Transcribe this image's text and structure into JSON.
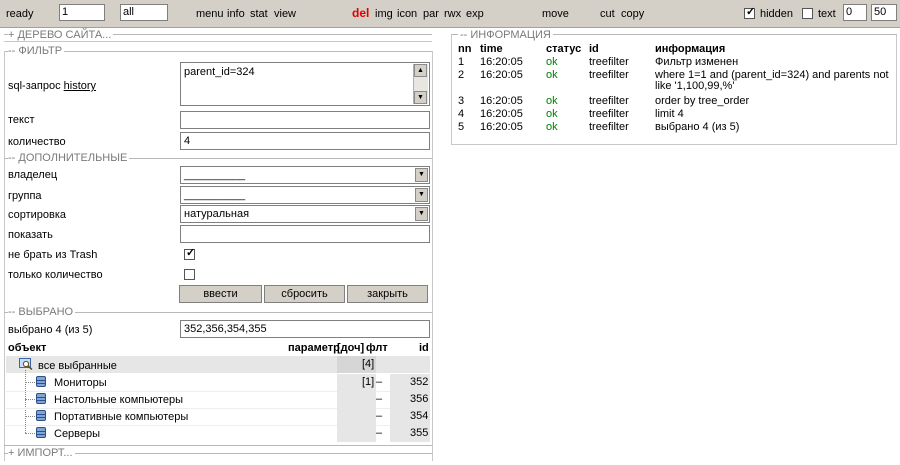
{
  "toolbar": {
    "status": "ready",
    "page_value": "1",
    "filter_value": "all",
    "menu": "menu",
    "info": "info",
    "stat": "stat",
    "view": "view",
    "del": "del",
    "img": "img",
    "icon": "icon",
    "par": "par",
    "rwx": "rwx",
    "exp": "exp",
    "move": "move",
    "cut": "cut",
    "copy": "copy",
    "hidden_label": "hidden",
    "hidden_checked": true,
    "text_label": "text",
    "text_checked": false,
    "offset": "0",
    "limit": "50"
  },
  "sections": {
    "tree": "+ ДЕРЕВО САЙТА...",
    "filter": "-- ФИЛЬТР",
    "additional": "-- ДОПОЛНИТЕЛЬНЫЕ",
    "selected": "-- ВЫБРАНО",
    "import": "+ ИМПОРТ...",
    "info": "-- ИНФОРМАЦИЯ"
  },
  "filter": {
    "sql_label": "sql-запрос",
    "history_link": "history",
    "sql_value": "parent_id=324",
    "text_label": "текст",
    "text_value": "",
    "count_label": "количество",
    "count_value": "4"
  },
  "additional": {
    "owner_label": "владелец",
    "owner_value": "__________",
    "group_label": "группа",
    "group_value": "__________",
    "sort_label": "сортировка",
    "sort_value": "натуральная",
    "show_label": "показать",
    "show_value": "",
    "no_trash_label": "не брать из Trash",
    "no_trash_checked": true,
    "only_count_label": "только количество",
    "only_count_checked": false
  },
  "buttons": {
    "submit": "ввести",
    "reset": "сбросить",
    "close": "закрыть"
  },
  "selected": {
    "label": "выбрано 4 (из 5)",
    "ids_value": "352,356,354,355"
  },
  "objects_table": {
    "headers": {
      "object": "объект",
      "param": "параметр",
      "doc": "[доч]",
      "flt": "флт",
      "id": "id"
    },
    "root": {
      "name": "все выбранные",
      "doc": "[4]"
    },
    "rows": [
      {
        "name": "Мониторы",
        "doc": "[1]",
        "flt": "–",
        "id": "352"
      },
      {
        "name": "Настольные компьютеры",
        "doc": "",
        "flt": "–",
        "id": "356"
      },
      {
        "name": "Портативные компьютеры",
        "doc": "",
        "flt": "–",
        "id": "354"
      },
      {
        "name": "Серверы",
        "doc": "",
        "flt": "–",
        "id": "355"
      }
    ]
  },
  "info_log": {
    "headers": {
      "nn": "nn",
      "time": "time",
      "status": "статус",
      "id": "id",
      "info": "информация"
    },
    "rows": [
      {
        "nn": "1",
        "time": "16:20:05",
        "status": "ok",
        "id": "treefilter",
        "info": "Фильтр изменен"
      },
      {
        "nn": "2",
        "time": "16:20:05",
        "status": "ok",
        "id": "treefilter",
        "info": "where 1=1 and (parent_id=324) and parents not like '1,100,99,%'"
      },
      {
        "nn": "3",
        "time": "16:20:05",
        "status": "ok",
        "id": "treefilter",
        "info": "order by tree_order"
      },
      {
        "nn": "4",
        "time": "16:20:05",
        "status": "ok",
        "id": "treefilter",
        "info": "limit 4"
      },
      {
        "nn": "5",
        "time": "16:20:05",
        "status": "ok",
        "id": "treefilter",
        "info": "выбрано 4 (из 5)"
      }
    ]
  }
}
